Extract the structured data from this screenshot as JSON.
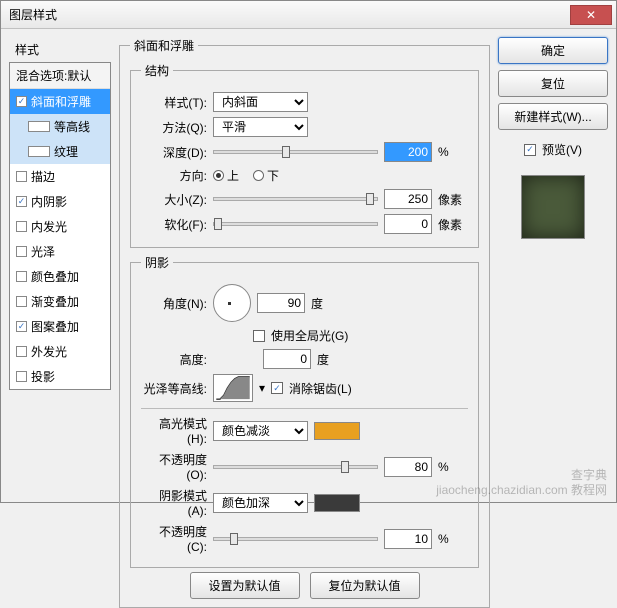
{
  "title": "图层样式",
  "styles": {
    "heading": "样式",
    "blend": "混合选项:默认",
    "items": [
      {
        "label": "斜面和浮雕",
        "checked": true,
        "selected": true
      },
      {
        "label": "等高线",
        "checked": false,
        "indent": true,
        "highlight": true
      },
      {
        "label": "纹理",
        "checked": false,
        "indent": true,
        "highlight": true
      },
      {
        "label": "描边",
        "checked": false
      },
      {
        "label": "内阴影",
        "checked": true
      },
      {
        "label": "内发光",
        "checked": false
      },
      {
        "label": "光泽",
        "checked": false
      },
      {
        "label": "颜色叠加",
        "checked": false
      },
      {
        "label": "渐变叠加",
        "checked": false
      },
      {
        "label": "图案叠加",
        "checked": true
      },
      {
        "label": "外发光",
        "checked": false
      },
      {
        "label": "投影",
        "checked": false
      }
    ]
  },
  "bevel": {
    "title": "斜面和浮雕",
    "structure": "结构",
    "styleLbl": "样式(T):",
    "styleVal": "内斜面",
    "techniqueLbl": "方法(Q):",
    "techniqueVal": "平滑",
    "depthLbl": "深度(D):",
    "depthVal": "200",
    "depthUnit": "%",
    "depthPos": 42,
    "directionLbl": "方向:",
    "upLbl": "上",
    "downLbl": "下",
    "sizeLbl": "大小(Z):",
    "sizeVal": "250",
    "sizeUnit": "像素",
    "sizePos": 93,
    "softenLbl": "软化(F):",
    "softenVal": "0",
    "softenUnit": "像素",
    "softenPos": 0
  },
  "shadow": {
    "title": "阴影",
    "angleLbl": "角度(N):",
    "angleVal": "90",
    "angleUnit": "度",
    "globalLbl": "使用全局光(G)",
    "globalChecked": false,
    "altLbl": "高度:",
    "altVal": "0",
    "altUnit": "度",
    "glossLbl": "光泽等高线:",
    "antiLbl": "消除锯齿(L)",
    "antiChecked": true,
    "hlModeLbl": "高光模式(H):",
    "hlModeVal": "颜色减淡",
    "hlColor": "#e8a020",
    "hlOpLbl": "不透明度(O):",
    "hlOpVal": "80",
    "hlOpUnit": "%",
    "hlOpPos": 78,
    "shModeLbl": "阴影模式(A):",
    "shModeVal": "颜色加深",
    "shColor": "#3a3a3a",
    "shOpLbl": "不透明度(C):",
    "shOpVal": "10",
    "shOpUnit": "%",
    "shOpPos": 10
  },
  "buttons": {
    "ok": "确定",
    "cancel": "复位",
    "newStyle": "新建样式(W)...",
    "previewLbl": "预览(V)",
    "setDefault": "设置为默认值",
    "resetDefault": "复位为默认值"
  },
  "watermark": {
    "l1": "查字典",
    "l2": "jiaocheng.chazidian.com 教程网"
  }
}
